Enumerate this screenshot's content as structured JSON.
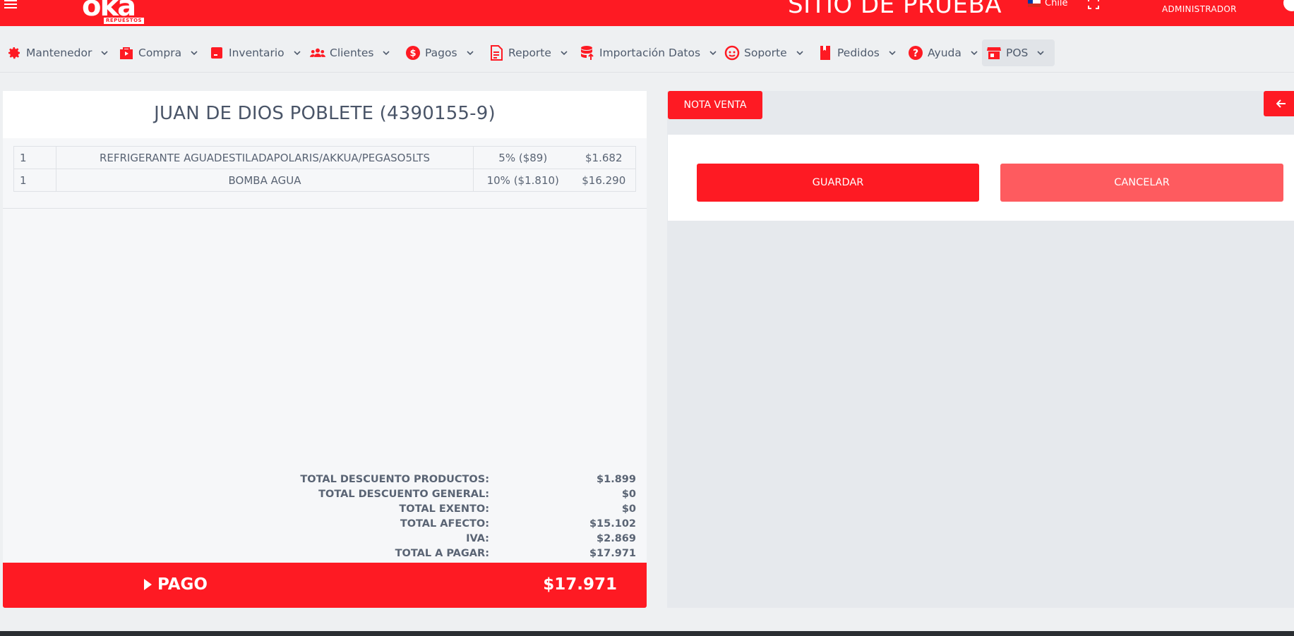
{
  "header": {
    "logo_text": "oka",
    "logo_subtext": "REPUESTOS",
    "site_title": "SITIO DE PRUEBA",
    "country": "Chile",
    "user_role": "ADMINISTRADOR"
  },
  "menu": [
    {
      "label": "Mantenedor",
      "icon": "gear-icon"
    },
    {
      "label": "Compra",
      "icon": "shopping-bag-icon"
    },
    {
      "label": "Inventario",
      "icon": "box-icon"
    },
    {
      "label": "Clientes",
      "icon": "users-icon"
    },
    {
      "label": "Pagos",
      "icon": "dollar-coin-icon"
    },
    {
      "label": "Reporte",
      "icon": "document-icon"
    },
    {
      "label": "Importación Datos",
      "icon": "database-import-icon"
    },
    {
      "label": "Soporte",
      "icon": "support-face-icon"
    },
    {
      "label": "Pedidos",
      "icon": "book-icon"
    },
    {
      "label": "Ayuda",
      "icon": "question-icon"
    },
    {
      "label": "POS",
      "icon": "store-icon",
      "active": true
    }
  ],
  "sale": {
    "customer": "JUAN DE DIOS POBLETE (4390155-9)",
    "items": [
      {
        "qty": "1",
        "description": "REFRIGERANTE AGUADESTILADAPOLARIS/AKKUA/PEGASO5LTS",
        "discount": "5% ($89)",
        "amount": "$1.682"
      },
      {
        "qty": "1",
        "description": "BOMBA AGUA",
        "discount": "10% ($1.810)",
        "amount": "$16.290"
      }
    ],
    "totals": [
      {
        "label": "TOTAL DESCUENTO PRODUCTOS:",
        "value": "$1.899"
      },
      {
        "label": "TOTAL DESCUENTO GENERAL:",
        "value": "$0"
      },
      {
        "label": "TOTAL EXENTO:",
        "value": "$0"
      },
      {
        "label": "TOTAL AFECTO:",
        "value": "$15.102"
      },
      {
        "label": "IVA:",
        "value": "$2.869"
      },
      {
        "label": "TOTAL A PAGAR:",
        "value": "$17.971"
      }
    ],
    "pay_label": "PAGO",
    "pay_total": "$17.971"
  },
  "actions": {
    "document_type": "NOTA VENTA",
    "save_label": "GUARDAR",
    "cancel_label": "CANCELAR"
  },
  "colors": {
    "brand_red": "#fe1a23",
    "cancel_red": "#fe5b5f"
  }
}
